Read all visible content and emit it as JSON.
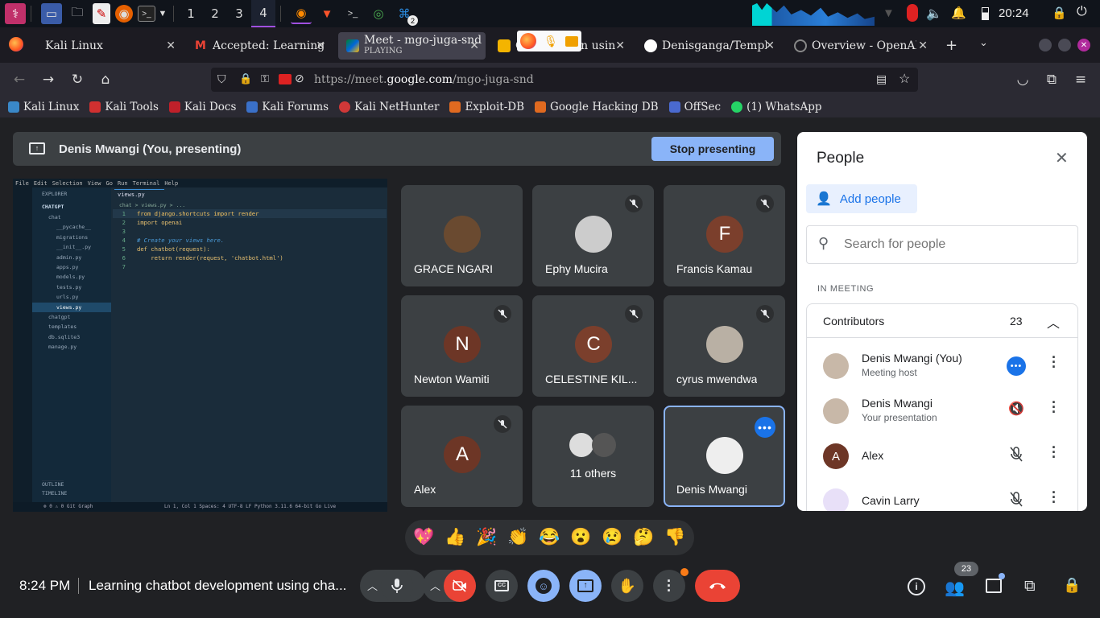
{
  "taskbar": {
    "workspaces": [
      "1",
      "2",
      "3",
      "4"
    ],
    "active_workspace": "4",
    "badge": "2",
    "clock": "20:24"
  },
  "tabs": [
    {
      "title": "Kali Linux"
    },
    {
      "title": "Accepted: Learning c"
    },
    {
      "title": "Meet - mgo-juga-snd",
      "sub": "PLAYING"
    },
    {
      "title": "C",
      "title_tail": "on usin"
    },
    {
      "title": "Denisganga/Templat"
    },
    {
      "title": "Overview - OpenAI A"
    }
  ],
  "nav": {
    "url_prefix": "https://meet.",
    "url_domain": "google.com",
    "url_path": "/mgo-juga-snd"
  },
  "bookmarks": [
    "Kali Linux",
    "Kali Tools",
    "Kali Docs",
    "Kali Forums",
    "Kali NetHunter",
    "Exploit-DB",
    "Google Hacking DB",
    "OffSec",
    "(1) WhatsApp"
  ],
  "meet": {
    "presenting_label": "Denis Mwangi (You, presenting)",
    "stop_presenting": "Stop presenting",
    "tiles": [
      {
        "name": "GRACE NGARI",
        "initial": "",
        "muted": false
      },
      {
        "name": "Ephy Mucira",
        "initial": "",
        "muted": true
      },
      {
        "name": "Francis Kamau",
        "initial": "F",
        "muted": true
      },
      {
        "name": "Newton Wamiti",
        "initial": "N",
        "muted": true
      },
      {
        "name": "CELESTINE KIL...",
        "initial": "C",
        "muted": true
      },
      {
        "name": "cyrus mwendwa",
        "initial": "",
        "muted": true
      },
      {
        "name": "Alex",
        "initial": "A",
        "muted": true
      },
      {
        "name": "11 others",
        "initial": "",
        "muted": false
      },
      {
        "name": "Denis Mwangi",
        "initial": "",
        "muted": false
      }
    ],
    "reactions": [
      "💖",
      "👍",
      "🎉",
      "👏",
      "😂",
      "😮",
      "😢",
      "🤔",
      "👎"
    ],
    "time": "8:24 PM",
    "meeting_title": "Learning chatbot development using cha...",
    "people_count": "23",
    "colors": {
      "accent": "#8ab4f8",
      "hangup": "#ea4335",
      "blue": "#1a73e8"
    }
  },
  "people_panel": {
    "title": "People",
    "add_people": "Add people",
    "search_placeholder": "Search for people",
    "in_meeting": "IN MEETING",
    "contributors_label": "Contributors",
    "contributors_count": "23",
    "people": [
      {
        "name": "Denis Mwangi (You)",
        "sub": "Meeting host",
        "initial": ""
      },
      {
        "name": "Denis Mwangi",
        "sub": "Your presentation",
        "initial": ""
      },
      {
        "name": "Alex",
        "sub": "",
        "initial": "A"
      },
      {
        "name": "Cavin Larry",
        "sub": "",
        "initial": ""
      }
    ]
  },
  "vscode": {
    "menu": [
      "File",
      "Edit",
      "Selection",
      "View",
      "Go",
      "Run",
      "Terminal",
      "Help"
    ],
    "explorer_label": "EXPLORER",
    "project": "CHATGPT",
    "tab": "views.py",
    "breadcrumb": "chat  >  views.py  >  ...",
    "tree": [
      "chat",
      "__pycache__",
      "migrations",
      "__init__.py",
      "admin.py",
      "apps.py",
      "models.py",
      "tests.py",
      "urls.py",
      "views.py",
      "chatgpt",
      "templates",
      "db.sqlite3",
      "manage.py"
    ],
    "outline": "OUTLINE",
    "timeline": "TIMELINE",
    "code_lines": [
      {
        "n": "1",
        "t": "from django.shortcuts import render"
      },
      {
        "n": "2",
        "t": "import openai"
      },
      {
        "n": "3",
        "t": ""
      },
      {
        "n": "4",
        "t": "# Create your views here."
      },
      {
        "n": "5",
        "t": "def chatbot(request):"
      },
      {
        "n": "6",
        "t": "    return render(request, 'chatbot.html')"
      },
      {
        "n": "7",
        "t": ""
      }
    ],
    "status": "Ln 1, Col 1   Spaces: 4   UTF-8   LF   Python   3.11.6 64-bit   Go Live",
    "status_left": "⊗ 0 ⚠ 0   Git Graph"
  }
}
